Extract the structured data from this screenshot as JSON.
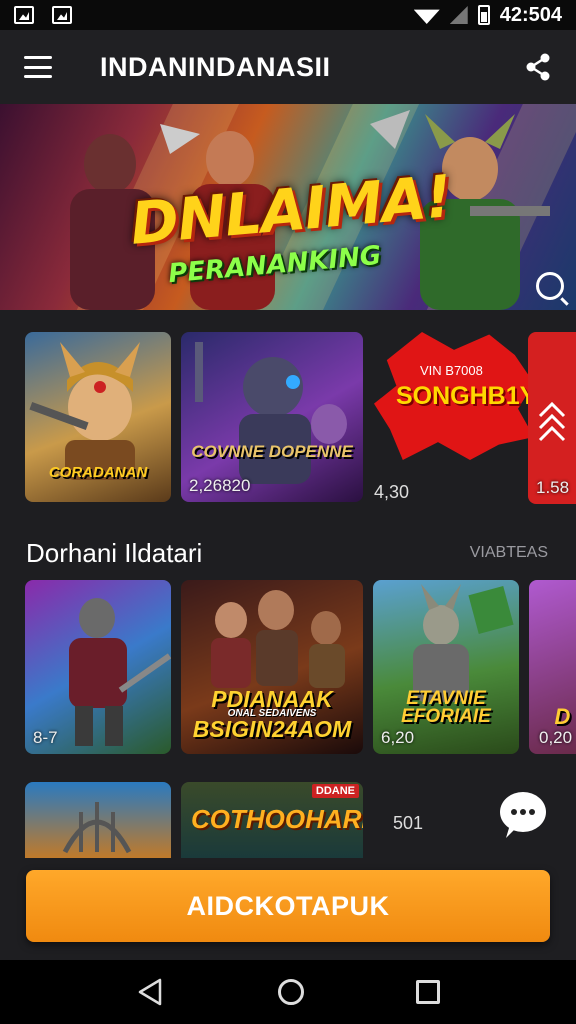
{
  "status_bar": {
    "time": "42:504"
  },
  "app_bar": {
    "title": "INDANINDANASII"
  },
  "hero": {
    "title": "DNLAIMA!",
    "subtitle": "PERANANKING"
  },
  "row1": {
    "cards": [
      {
        "badge": "CORADANAN",
        "value": ""
      },
      {
        "badge": "COVNNE DOPENNE",
        "value": "2,26820"
      },
      {
        "badge": "",
        "value": "1.58"
      }
    ],
    "promo": {
      "top": "VIN B7008",
      "main": "SONGHB1Y",
      "value": "4,30"
    }
  },
  "section": {
    "title": "Dorhani Ildatari",
    "link": "VIABTEAS"
  },
  "row2": {
    "cards": [
      {
        "badge": "",
        "value": "8-7"
      },
      {
        "badge": "PDIANAAK BSIGIN24AOM",
        "badge_small": "ONAL SEDAIVENS",
        "value": ""
      },
      {
        "badge": "ETAVNIE EFORIAIE",
        "value": "6,20"
      },
      {
        "badge": "D",
        "value": "0,20"
      }
    ]
  },
  "row3": {
    "cards": [
      {
        "badge": ""
      },
      {
        "badge": "COTHOOHARI",
        "tag": "DDANE"
      }
    ],
    "value": "501"
  },
  "cta": {
    "label": "AIDCKOTAPUK"
  },
  "colors": {
    "accent": "#f59a1c",
    "background": "#1e1e21",
    "promo_red": "#e01515"
  }
}
